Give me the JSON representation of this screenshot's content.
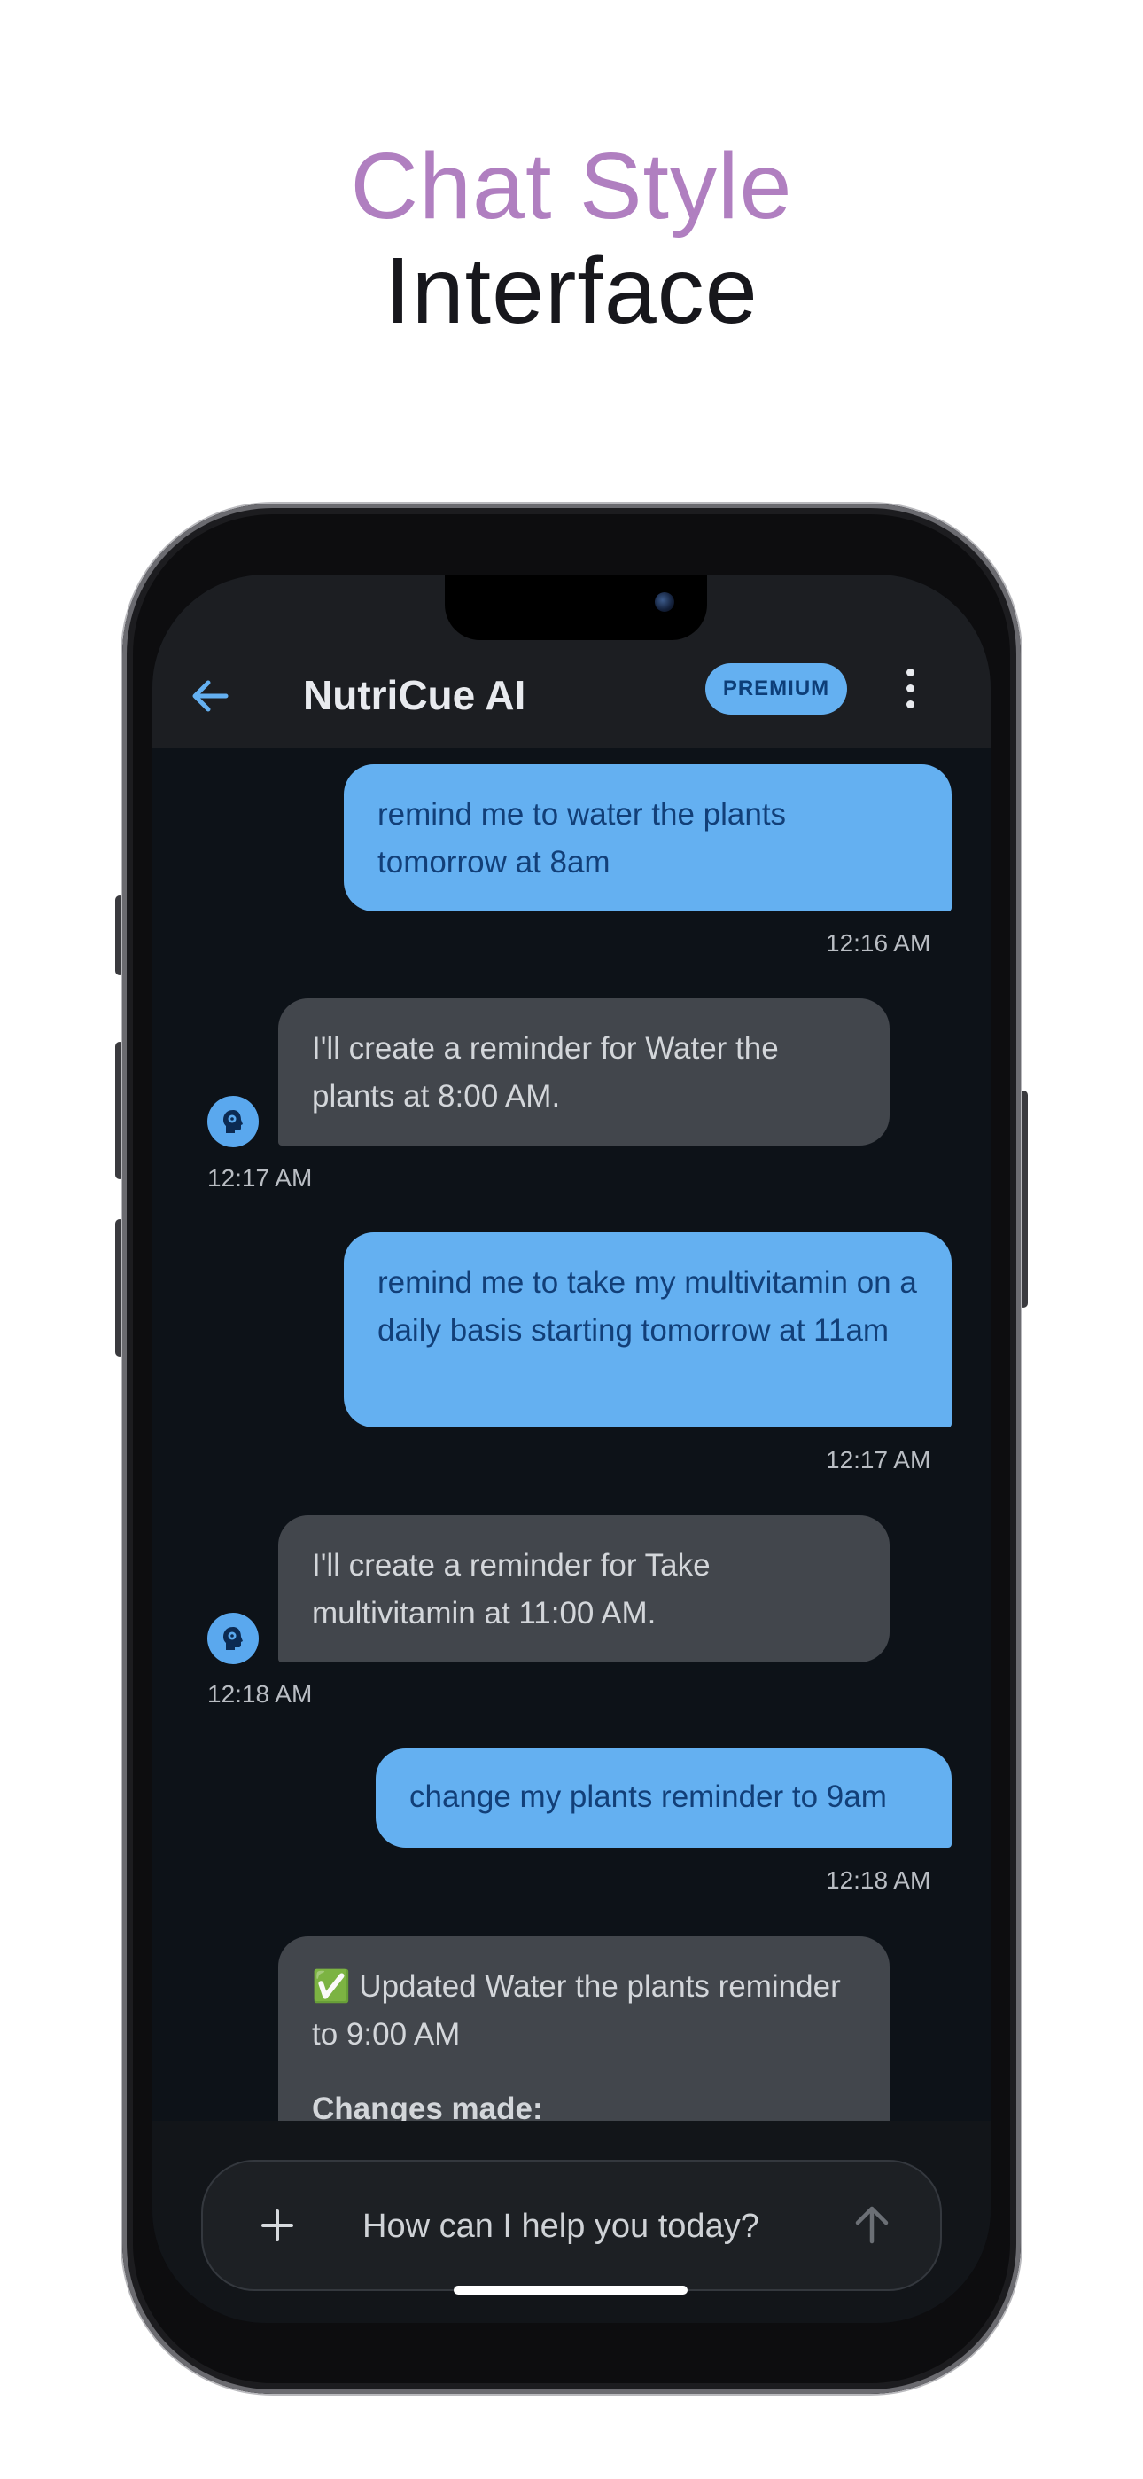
{
  "headline": {
    "line1": "Chat Style",
    "line2": "Interface"
  },
  "appbar": {
    "title": "NutriCue AI",
    "badge": "PREMIUM"
  },
  "messages": [
    {
      "role": "user",
      "text": "remind me to water the plants tomorrow at 8am",
      "time": "12:16 AM"
    },
    {
      "role": "ai",
      "text": "I'll create a reminder for Water the plants at 8:00 AM.",
      "time": "12:17 AM"
    },
    {
      "role": "user",
      "text": "remind me to take my multivitamin on a daily basis starting tomorrow at 11am",
      "time": "12:17 AM"
    },
    {
      "role": "ai",
      "text": "I'll create a reminder for Take multivitamin at 11:00 AM.",
      "time": "12:18 AM"
    },
    {
      "role": "user",
      "text": "change my plants reminder to 9am",
      "time": "12:18 AM"
    },
    {
      "role": "ai",
      "text": "✅ Updated Water the plants reminder to 9:00 AM",
      "subtext": "Changes made:"
    }
  ],
  "composer": {
    "placeholder": "How can I help you today?"
  },
  "colors": {
    "accent": "#64b0f1",
    "headline_purple": "#b07fc0",
    "user_bubble": "#64b0f1",
    "ai_bubble": "#42464c",
    "chat_background": "#0d1218"
  },
  "icons": {
    "back": "arrow-left-icon",
    "menu": "more-vertical-icon",
    "attach": "plus-icon",
    "send": "arrow-up-icon",
    "bot": "brain-head-icon"
  }
}
